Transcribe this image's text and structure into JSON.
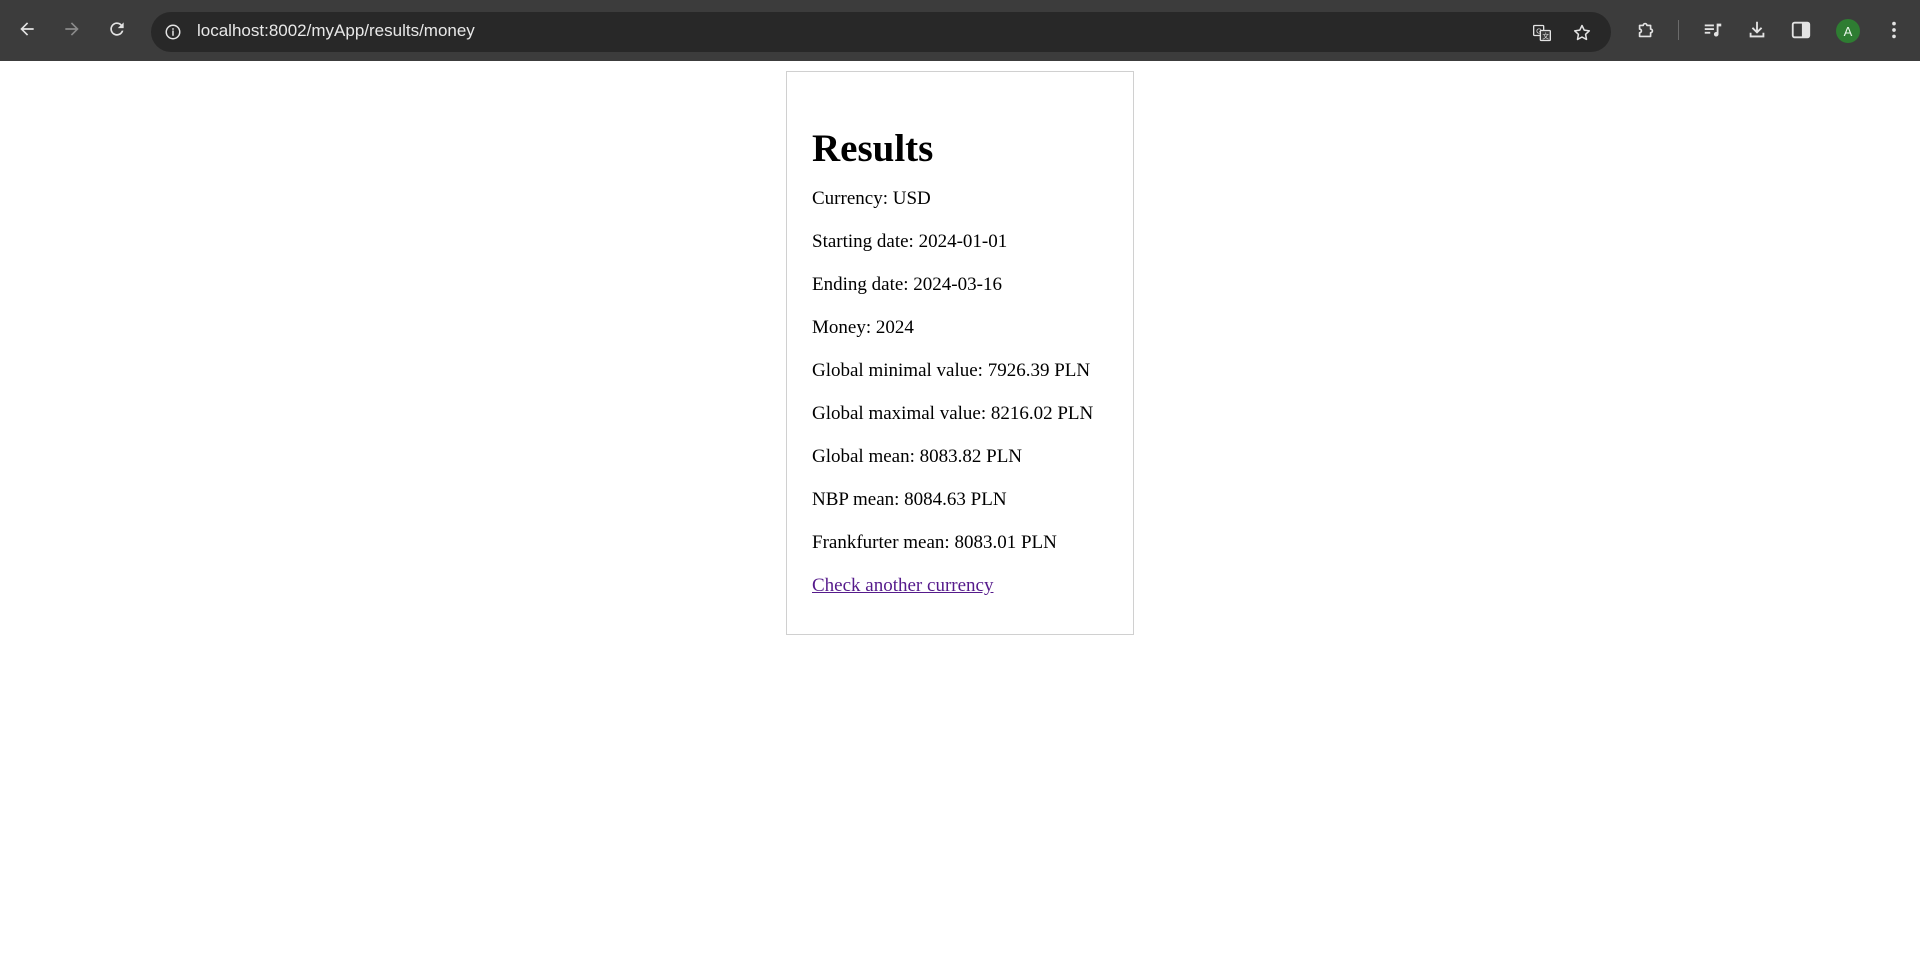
{
  "browser": {
    "url": "localhost:8002/myApp/results/money",
    "profile_initial": "A",
    "icons": {
      "back": "back-arrow-icon",
      "forward": "forward-arrow-icon",
      "reload": "reload-icon",
      "site_info": "info-icon",
      "translate": "translate-icon",
      "bookmark": "star-icon",
      "extensions": "puzzle-icon",
      "media": "media-queue-icon",
      "downloads": "download-icon",
      "side_panel": "side-panel-icon",
      "menu": "kebab-menu-icon"
    },
    "colors": {
      "toolbar": "#3c3c3c",
      "omnibox": "#282828",
      "avatar": "#2e7d32"
    }
  },
  "results": {
    "title": "Results",
    "currency": "Currency: USD",
    "starting_date": "Starting date: 2024-01-01",
    "ending_date": "Ending date: 2024-03-16",
    "money": "Money: 2024",
    "global_min": "Global minimal value: 7926.39 PLN",
    "global_max": "Global maximal value: 8216.02 PLN",
    "global_mean": "Global mean: 8083.82 PLN",
    "nbp_mean": "NBP mean: 8084.63 PLN",
    "frankfurter_mean": "Frankfurter mean: 8083.01 PLN",
    "link": "Check another currency"
  }
}
